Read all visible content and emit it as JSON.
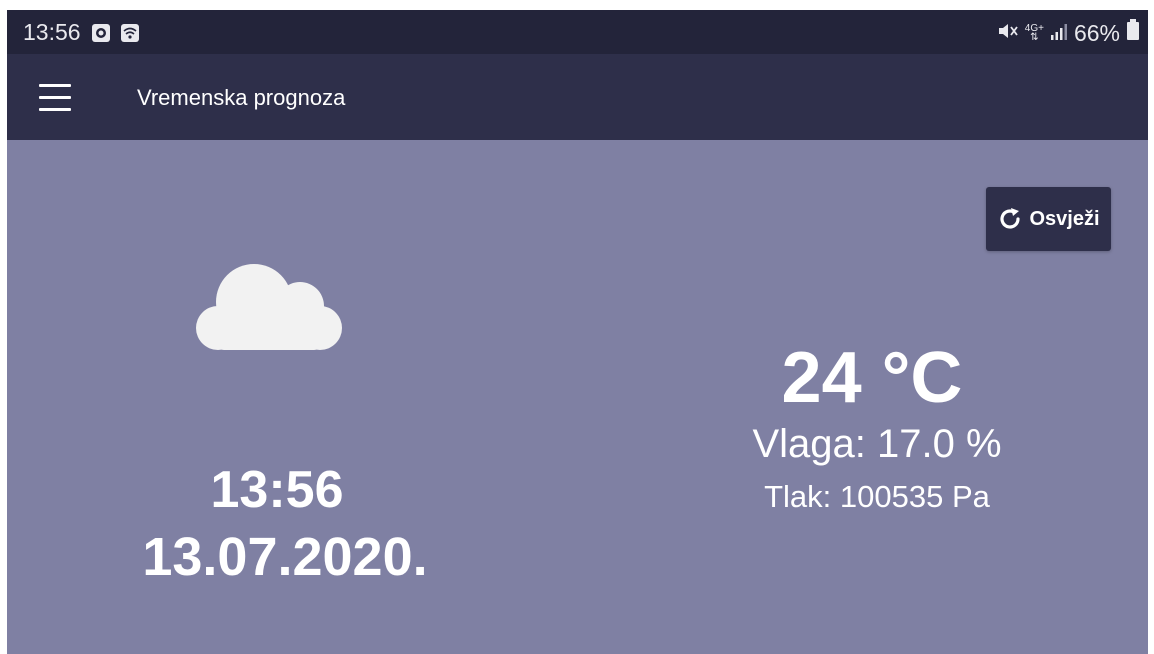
{
  "status_bar": {
    "time": "13:56",
    "icons": [
      "screen-record-icon",
      "wifi-icon",
      "mute-icon",
      "network-4g-icon",
      "signal-icon",
      "battery-icon"
    ],
    "network_label": "4G+",
    "battery": "66%"
  },
  "app_bar": {
    "title": "Vremenska prognoza",
    "menu_icon": "hamburger-menu-icon"
  },
  "refresh": {
    "label": "Osvježi",
    "icon": "refresh-icon"
  },
  "weather": {
    "icon": "cloud-icon",
    "temperature": "24 °C",
    "humidity": "Vlaga: 17.0 %",
    "pressure": "Tlak: 100535 Pa"
  },
  "clock": {
    "time": "13:56",
    "date": "13.07.2020."
  },
  "colors": {
    "background": "#7f80a3",
    "app_bar": "#2e2f4a",
    "status_bar": "#23243a",
    "text": "#ffffff",
    "cloud": "#f2f2f2"
  }
}
